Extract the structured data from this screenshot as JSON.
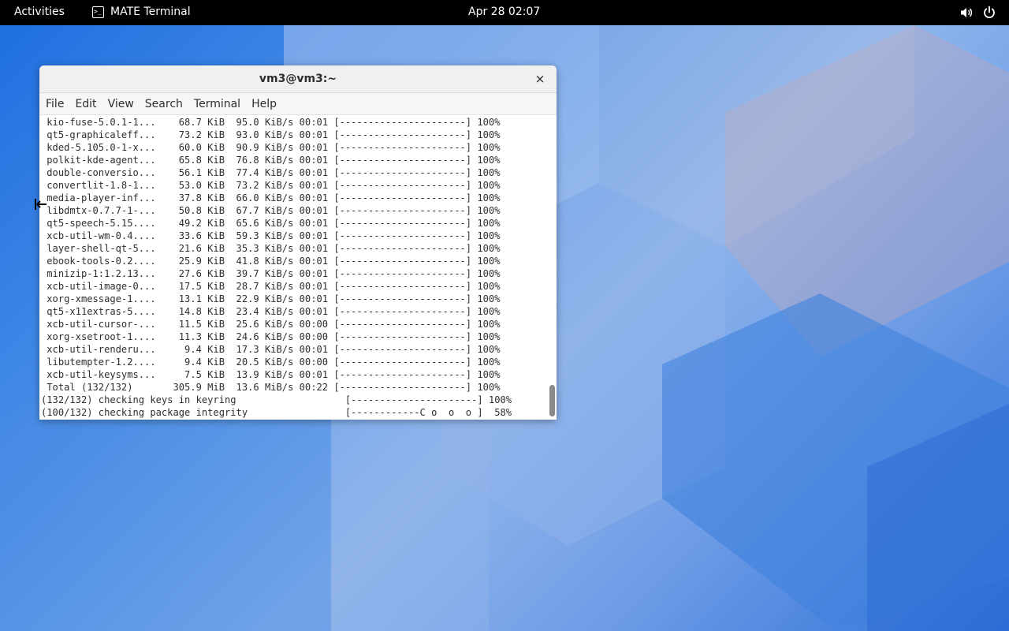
{
  "topbar": {
    "activities": "Activities",
    "app_name": "MATE Terminal",
    "app_icon_glyph": ">_",
    "clock": "Apr 28  02:07",
    "volume_icon": "speaker-icon",
    "power_icon": "power-icon"
  },
  "window": {
    "title": "vm3@vm3:~",
    "close_label": "×",
    "menu": [
      "File",
      "Edit",
      "View",
      "Search",
      "Terminal",
      "Help"
    ]
  },
  "terminal": {
    "lines": [
      " kio-fuse-5.0.1-1...    68.7 KiB  95.0 KiB/s 00:01 [----------------------] 100%",
      " qt5-graphicaleff...    73.2 KiB  93.0 KiB/s 00:01 [----------------------] 100%",
      " kded-5.105.0-1-x...    60.0 KiB  90.9 KiB/s 00:01 [----------------------] 100%",
      " polkit-kde-agent...    65.8 KiB  76.8 KiB/s 00:01 [----------------------] 100%",
      " double-conversio...    56.1 KiB  77.4 KiB/s 00:01 [----------------------] 100%",
      " convertlit-1.8-1...    53.0 KiB  73.2 KiB/s 00:01 [----------------------] 100%",
      " media-player-inf...    37.8 KiB  66.0 KiB/s 00:01 [----------------------] 100%",
      " libdmtx-0.7.7-1-...    50.8 KiB  67.7 KiB/s 00:01 [----------------------] 100%",
      " qt5-speech-5.15....    49.2 KiB  65.6 KiB/s 00:01 [----------------------] 100%",
      " xcb-util-wm-0.4....    33.6 KiB  59.3 KiB/s 00:01 [----------------------] 100%",
      " layer-shell-qt-5...    21.6 KiB  35.3 KiB/s 00:01 [----------------------] 100%",
      " ebook-tools-0.2....    25.9 KiB  41.8 KiB/s 00:01 [----------------------] 100%",
      " minizip-1:1.2.13...    27.6 KiB  39.7 KiB/s 00:01 [----------------------] 100%",
      " xcb-util-image-0...    17.5 KiB  28.7 KiB/s 00:01 [----------------------] 100%",
      " xorg-xmessage-1....    13.1 KiB  22.9 KiB/s 00:01 [----------------------] 100%",
      " qt5-x11extras-5....    14.8 KiB  23.4 KiB/s 00:01 [----------------------] 100%",
      " xcb-util-cursor-...    11.5 KiB  25.6 KiB/s 00:00 [----------------------] 100%",
      " xorg-xsetroot-1....    11.3 KiB  24.6 KiB/s 00:00 [----------------------] 100%",
      " xcb-util-renderu...     9.4 KiB  17.3 KiB/s 00:01 [----------------------] 100%",
      " libutempter-1.2....     9.4 KiB  20.5 KiB/s 00:00 [----------------------] 100%",
      " xcb-util-keysyms...     7.5 KiB  13.9 KiB/s 00:01 [----------------------] 100%",
      " Total (132/132)       305.9 MiB  13.6 MiB/s 00:22 [----------------------] 100%",
      "(132/132) checking keys in keyring                   [----------------------] 100%",
      "(100/132) checking package integrity                 [------------C o  o  o ]  58%"
    ]
  }
}
